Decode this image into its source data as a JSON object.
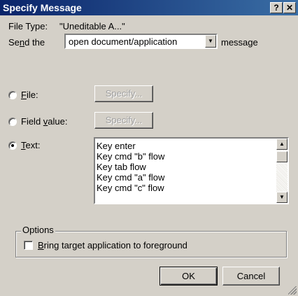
{
  "window": {
    "title": "Specify Message",
    "help_label": "?",
    "close_label": "✕"
  },
  "file_type": {
    "label": "File Type:",
    "value": "\"Uneditable A...\""
  },
  "send": {
    "prefix": "Send the",
    "selected": "open document/application",
    "suffix": "message"
  },
  "source": {
    "file_label": "File:",
    "field_label": "Field value:",
    "text_label": "Text:",
    "selected": "text",
    "specify_label": "Specify..."
  },
  "text_items": [
    "Key enter",
    "Key cmd \"b\" flow",
    "Key tab flow",
    "Key cmd \"a\" flow",
    "Key cmd \"c\" flow"
  ],
  "options": {
    "group_label": "Options",
    "bring_to_front_label": "Bring target application to foreground",
    "bring_to_front_checked": false
  },
  "buttons": {
    "ok": "OK",
    "cancel": "Cancel"
  },
  "colors": {
    "titlebar_start": "#0a246a",
    "titlebar_end": "#3a6ea5",
    "face": "#d4d0c8"
  }
}
